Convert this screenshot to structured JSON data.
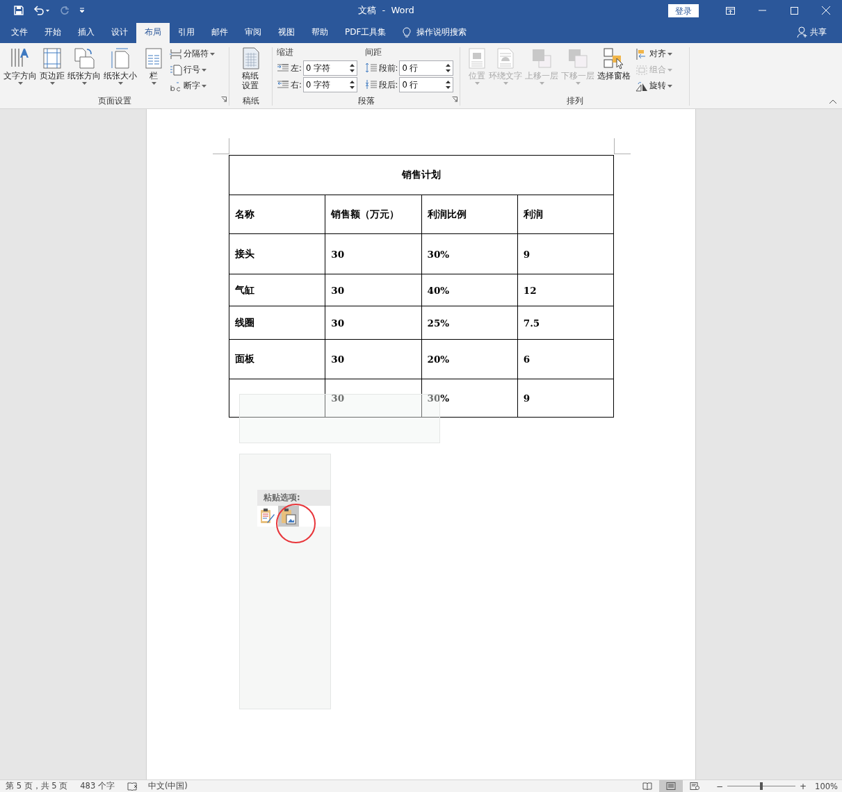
{
  "window": {
    "title": "文稿  -  Word",
    "sign_in": "登录"
  },
  "tabs": [
    {
      "label": "文件",
      "selected": false
    },
    {
      "label": "开始",
      "selected": false
    },
    {
      "label": "插入",
      "selected": false
    },
    {
      "label": "设计",
      "selected": false
    },
    {
      "label": "布局",
      "selected": true
    },
    {
      "label": "引用",
      "selected": false
    },
    {
      "label": "邮件",
      "selected": false
    },
    {
      "label": "审阅",
      "selected": false
    },
    {
      "label": "视图",
      "selected": false
    },
    {
      "label": "帮助",
      "selected": false
    },
    {
      "label": "PDF工具集",
      "selected": false
    }
  ],
  "tell_me": "操作说明搜索",
  "share": "共享",
  "page_setup": {
    "label": "页面设置",
    "large_buttons": [
      {
        "kind": "text-direction",
        "label": "文字方向"
      },
      {
        "kind": "margins",
        "label": "页边距"
      },
      {
        "kind": "orientation",
        "label": "纸张方向"
      },
      {
        "kind": "size",
        "label": "纸张大小"
      },
      {
        "kind": "columns",
        "label": "栏"
      }
    ],
    "small_buttons": [
      {
        "kind": "breaks",
        "label": "分隔符"
      },
      {
        "kind": "line-numbers",
        "label": "行号"
      },
      {
        "kind": "hyphenation",
        "label": "断字"
      }
    ]
  },
  "draft": {
    "label": "稿纸",
    "button": "稿纸设置"
  },
  "paragraph": {
    "label": "段落",
    "indent_label": "缩进",
    "spacing_label": "间距",
    "fields": [
      {
        "kind": "indent-left",
        "label": "左:",
        "value": "0 字符"
      },
      {
        "kind": "indent-right",
        "label": "右:",
        "value": "0 字符"
      },
      {
        "kind": "before",
        "label": "段前:",
        "value": "0 行"
      },
      {
        "kind": "after",
        "label": "段后:",
        "value": "0 行"
      }
    ]
  },
  "arrange": {
    "label": "排列",
    "large_buttons": [
      {
        "kind": "position",
        "label": "位置",
        "disabled": true
      },
      {
        "kind": "wrap",
        "label": "环绕文字",
        "disabled": true
      },
      {
        "kind": "forward",
        "label": "上移一层",
        "disabled": true
      },
      {
        "kind": "backward",
        "label": "下移一层",
        "disabled": true
      },
      {
        "kind": "pane",
        "label": "选择窗格",
        "disabled": false
      }
    ],
    "small_buttons": [
      {
        "kind": "align",
        "label": "对齐",
        "disabled": false
      },
      {
        "kind": "group",
        "label": "组合",
        "disabled": true
      },
      {
        "kind": "rotate",
        "label": "旋转",
        "disabled": false
      }
    ]
  },
  "table": {
    "title": "销售计划",
    "columns": [
      "名称",
      "销售额（万元）",
      "利润比例",
      "利润"
    ],
    "rows": [
      [
        "接头",
        "30",
        "30%",
        "9"
      ],
      [
        "气缸",
        "30",
        "40%",
        "12"
      ],
      [
        "线圈",
        "30",
        "25%",
        "7.5"
      ],
      [
        "面板",
        "30",
        "20%",
        "6"
      ],
      [
        "",
        "30",
        "30%",
        "9"
      ]
    ]
  },
  "paste_menu": {
    "title": "粘贴选项:",
    "options": [
      {
        "kind": "keep-format",
        "selected": false
      },
      {
        "kind": "picture",
        "selected": true
      }
    ]
  },
  "status_bar": {
    "page": "第 5 页，共 5 页",
    "words": "483 个字",
    "language": "中文(中国)",
    "views": [
      {
        "kind": "read",
        "selected": false
      },
      {
        "kind": "print",
        "selected": true
      },
      {
        "kind": "web",
        "selected": false
      }
    ],
    "zoom": {
      "minus": "−",
      "plus": "+",
      "level": 0.5,
      "percent": "100%"
    }
  }
}
